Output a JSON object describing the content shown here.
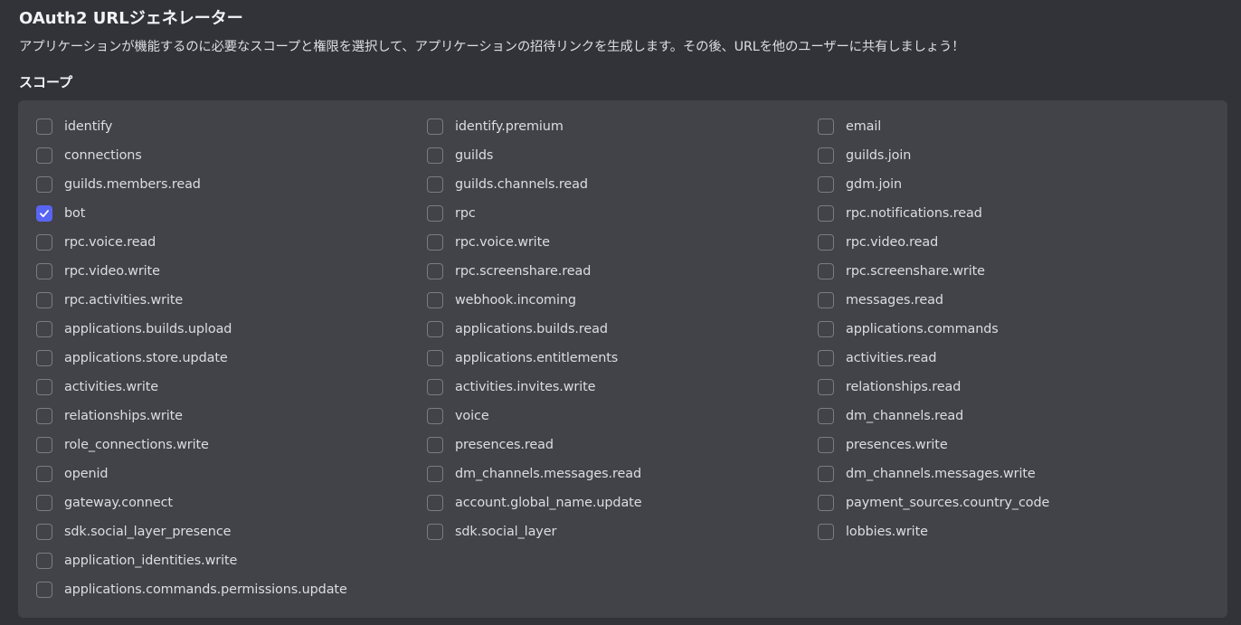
{
  "page": {
    "title": "OAuth2 URLジェネレーター",
    "description": "アプリケーションが機能するのに必要なスコープと権限を選択して、アプリケーションの招待リンクを生成します。その後、URLを他のユーザーに共有しましょう！"
  },
  "scopes": {
    "heading": "スコープ",
    "accent_color": "#5865f2",
    "items": [
      {
        "label": "identify",
        "checked": false
      },
      {
        "label": "identify.premium",
        "checked": false
      },
      {
        "label": "email",
        "checked": false
      },
      {
        "label": "connections",
        "checked": false
      },
      {
        "label": "guilds",
        "checked": false
      },
      {
        "label": "guilds.join",
        "checked": false
      },
      {
        "label": "guilds.members.read",
        "checked": false
      },
      {
        "label": "guilds.channels.read",
        "checked": false
      },
      {
        "label": "gdm.join",
        "checked": false
      },
      {
        "label": "bot",
        "checked": true
      },
      {
        "label": "rpc",
        "checked": false
      },
      {
        "label": "rpc.notifications.read",
        "checked": false
      },
      {
        "label": "rpc.voice.read",
        "checked": false
      },
      {
        "label": "rpc.voice.write",
        "checked": false
      },
      {
        "label": "rpc.video.read",
        "checked": false
      },
      {
        "label": "rpc.video.write",
        "checked": false
      },
      {
        "label": "rpc.screenshare.read",
        "checked": false
      },
      {
        "label": "rpc.screenshare.write",
        "checked": false
      },
      {
        "label": "rpc.activities.write",
        "checked": false
      },
      {
        "label": "webhook.incoming",
        "checked": false
      },
      {
        "label": "messages.read",
        "checked": false
      },
      {
        "label": "applications.builds.upload",
        "checked": false
      },
      {
        "label": "applications.builds.read",
        "checked": false
      },
      {
        "label": "applications.commands",
        "checked": false
      },
      {
        "label": "applications.store.update",
        "checked": false
      },
      {
        "label": "applications.entitlements",
        "checked": false
      },
      {
        "label": "activities.read",
        "checked": false
      },
      {
        "label": "activities.write",
        "checked": false
      },
      {
        "label": "activities.invites.write",
        "checked": false
      },
      {
        "label": "relationships.read",
        "checked": false
      },
      {
        "label": "relationships.write",
        "checked": false
      },
      {
        "label": "voice",
        "checked": false
      },
      {
        "label": "dm_channels.read",
        "checked": false
      },
      {
        "label": "role_connections.write",
        "checked": false
      },
      {
        "label": "presences.read",
        "checked": false
      },
      {
        "label": "presences.write",
        "checked": false
      },
      {
        "label": "openid",
        "checked": false
      },
      {
        "label": "dm_channels.messages.read",
        "checked": false
      },
      {
        "label": "dm_channels.messages.write",
        "checked": false
      },
      {
        "label": "gateway.connect",
        "checked": false
      },
      {
        "label": "account.global_name.update",
        "checked": false
      },
      {
        "label": "payment_sources.country_code",
        "checked": false
      },
      {
        "label": "sdk.social_layer_presence",
        "checked": false
      },
      {
        "label": "sdk.social_layer",
        "checked": false
      },
      {
        "label": "lobbies.write",
        "checked": false
      },
      {
        "label": "application_identities.write",
        "checked": false
      },
      {
        "label": "",
        "checked": false,
        "empty": true
      },
      {
        "label": "",
        "checked": false,
        "empty": true
      },
      {
        "label": "applications.commands.permissions.update",
        "checked": false
      }
    ]
  }
}
